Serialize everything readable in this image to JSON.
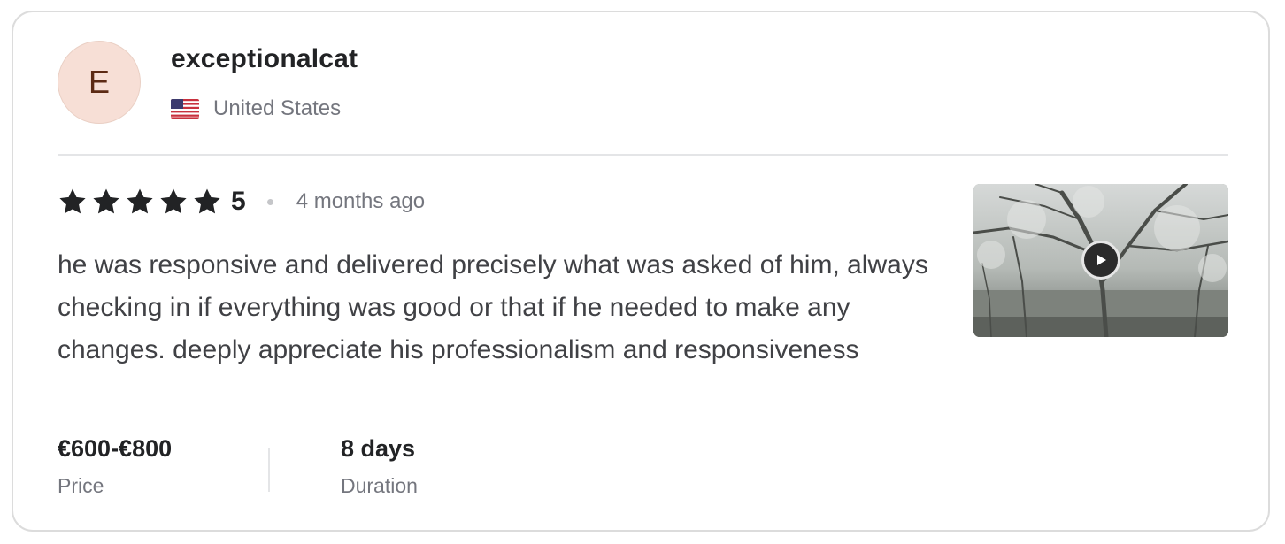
{
  "reviewer": {
    "avatar_initial": "E",
    "username": "exceptionalcat",
    "country": "United States",
    "flag_icon": "us-flag-icon"
  },
  "rating": {
    "stars": 5,
    "value": "5",
    "time_ago": "4 months ago"
  },
  "review": {
    "text": "he was responsive and delivered precisely what was asked of him, always checking in if everything was good or that if he needed to make any changes. deeply appreciate his professionalism and responsiveness"
  },
  "media": {
    "type": "video",
    "icon": "play-icon"
  },
  "details": {
    "price_value": "€600-€800",
    "price_label": "Price",
    "duration_value": "8 days",
    "duration_label": "Duration"
  },
  "colors": {
    "text_primary": "#222325",
    "text_secondary": "#74767e",
    "avatar_bg": "#f7dfd6",
    "avatar_text": "#5c2a14"
  }
}
